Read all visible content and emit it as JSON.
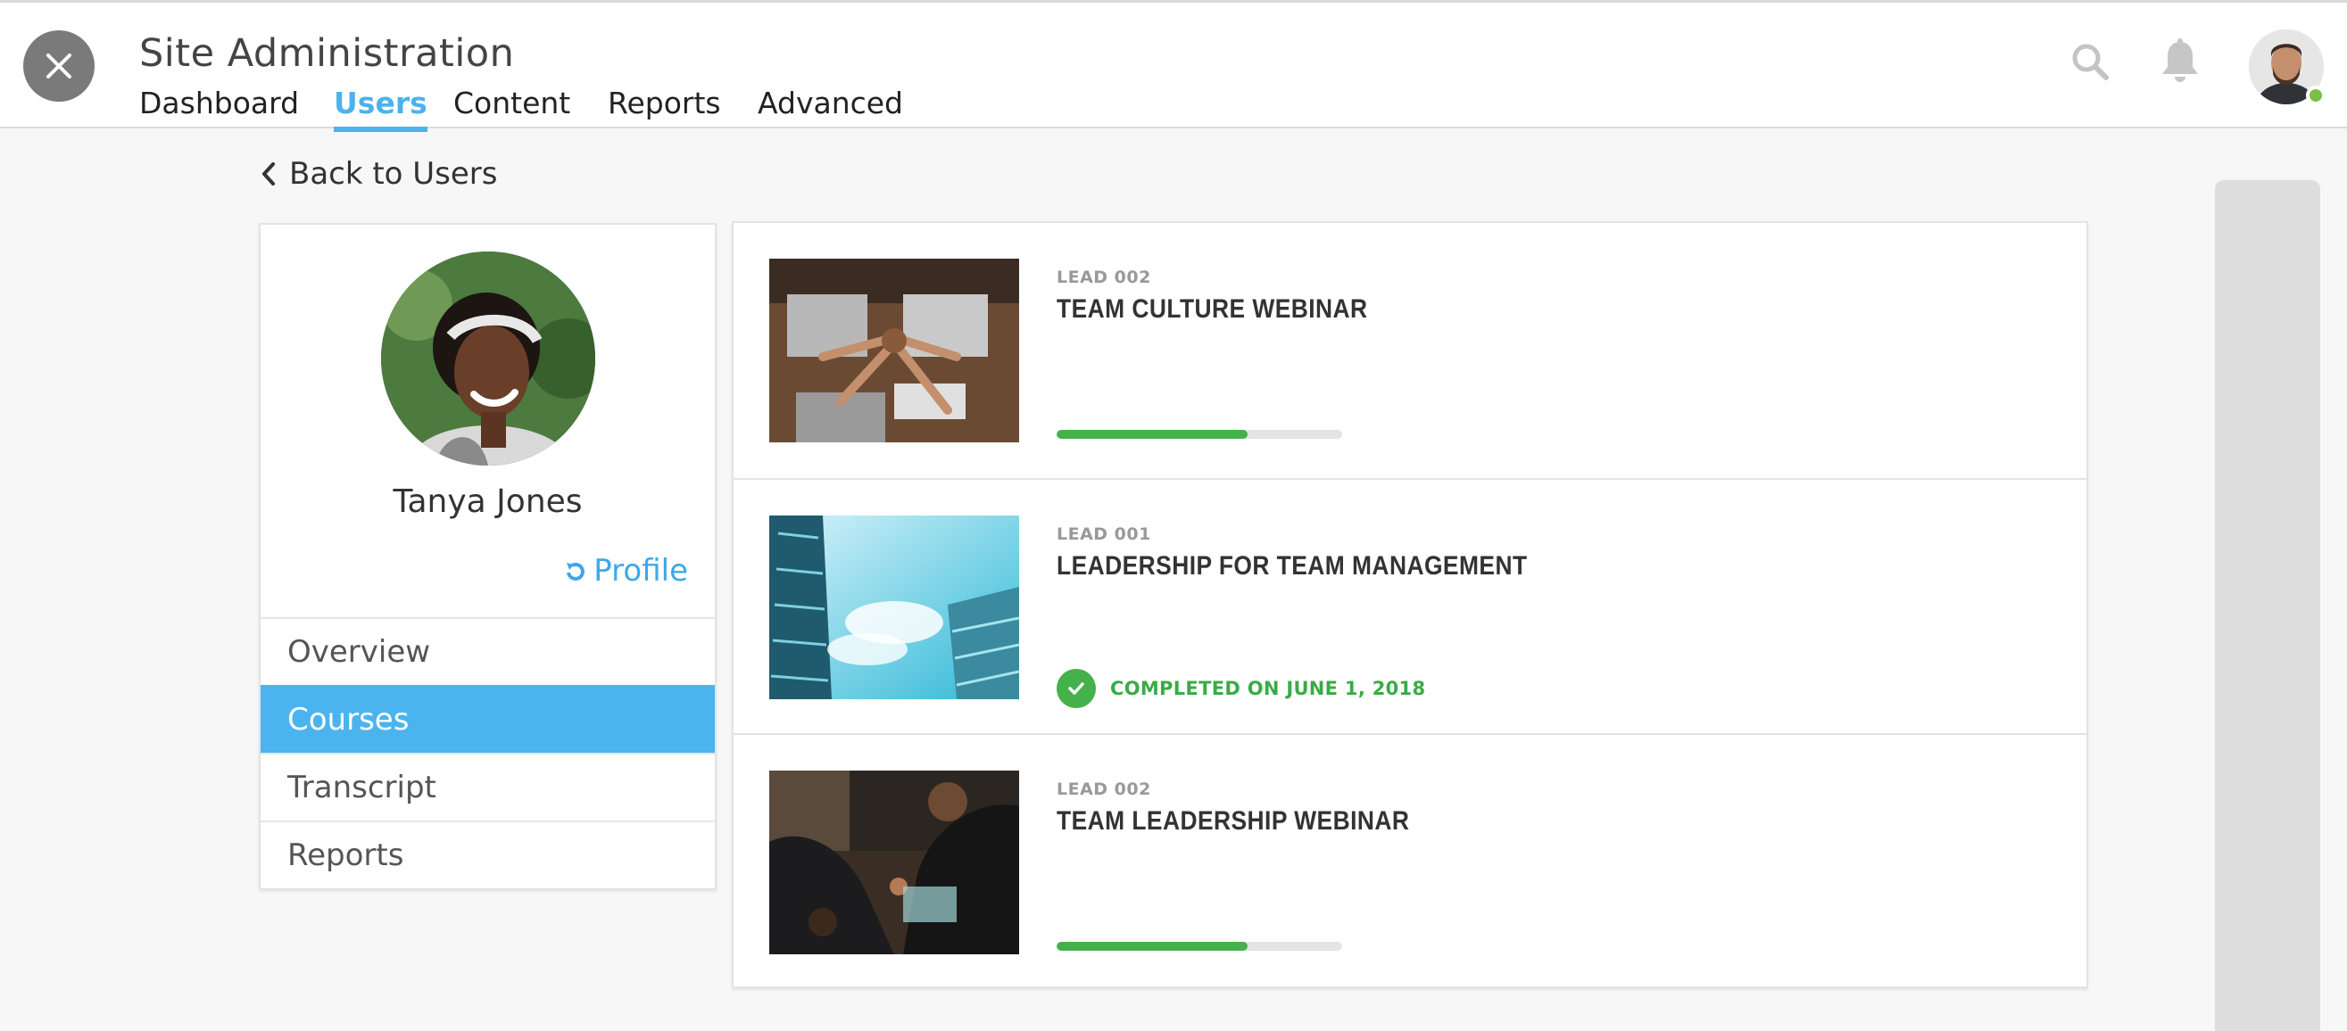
{
  "header": {
    "title": "Site Administration",
    "tabs": [
      {
        "label": "Dashboard"
      },
      {
        "label": "Users",
        "active": true
      },
      {
        "label": "Content"
      },
      {
        "label": "Reports"
      },
      {
        "label": "Advanced"
      }
    ],
    "icons": [
      "close-icon",
      "search-icon",
      "bell-icon",
      "user-avatar"
    ]
  },
  "back_link": {
    "label": "Back to Users",
    "icon": "chevron-left-icon"
  },
  "profile": {
    "name": "Tanya Jones",
    "profile_link": "Profile",
    "profile_link_icon": "refresh-icon",
    "menu": [
      {
        "label": "Overview"
      },
      {
        "label": "Courses",
        "active": true
      },
      {
        "label": "Transcript"
      },
      {
        "label": "Reports"
      }
    ]
  },
  "courses": [
    {
      "code": "LEAD 002",
      "title": "TEAM CULTURE WEBINAR",
      "progress": 0.67,
      "status": "in-progress"
    },
    {
      "code": "LEAD 001",
      "title": "LEADERSHIP FOR TEAM MANAGEMENT",
      "status": "completed",
      "completed_text": "COMPLETED ON JUNE 1, 2018"
    },
    {
      "code": "LEAD 002",
      "title": "TEAM LEADERSHIP WEBINAR",
      "progress": 0.67,
      "status": "in-progress"
    }
  ],
  "colors": {
    "accent": "#4db2ec",
    "progress": "#44b14b",
    "completed": "#3aab46",
    "active_menu": "#4bb4ee"
  }
}
